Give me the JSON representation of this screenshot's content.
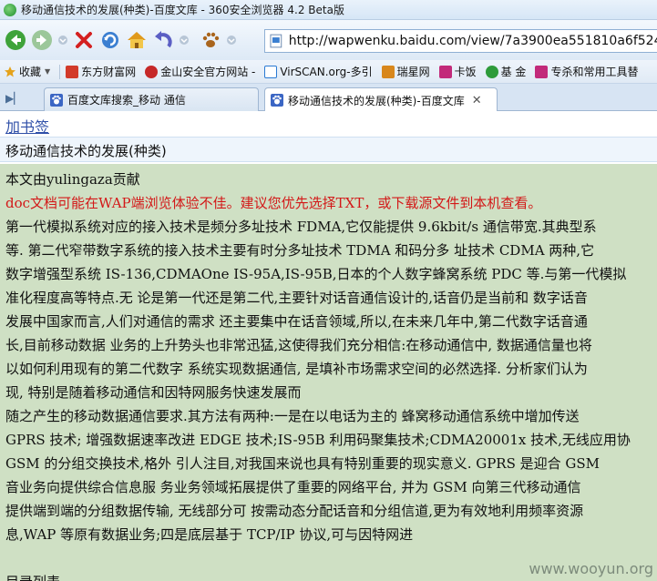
{
  "window": {
    "title": "移动通信技术的发展(种类)-百度文库 - 360安全浏览器 4.2 Beta版"
  },
  "toolbar": {
    "buttons": [
      "back-icon",
      "forward-icon",
      "dropdown-icon",
      "stop-icon",
      "refresh-icon",
      "home-icon",
      "undo-icon",
      "dropdown-icon",
      "paw-icon",
      "dropdown-icon"
    ],
    "url": "http://wapwenku.baidu.com/view/7a3900ea551810a6f52486"
  },
  "bookmarks": [
    {
      "label": "收藏",
      "color": "#e5a21a"
    },
    {
      "label": "东方财富网",
      "color": "#d23a2a"
    },
    {
      "label": "金山安全官方网站 -",
      "color": "#c62828"
    },
    {
      "label": "VirSCAN.org-多引",
      "color": "#2a7ad3"
    },
    {
      "label": "瑞星网",
      "color": "#d8871c"
    },
    {
      "label": "卡饭",
      "color": "#c22a7a"
    },
    {
      "label": "基 金",
      "color": "#2e9b3a"
    },
    {
      "label": "专杀和常用工具替",
      "color": "#c22a7a"
    }
  ],
  "tabs": [
    {
      "label": "百度文库搜索_移动 通信"
    },
    {
      "label": "移动通信技术的发展(种类)-百度文库"
    }
  ],
  "page": {
    "add_bookmark": "加书签",
    "doc_title": "移动通信技术的发展(种类)",
    "contributor": "本文由yulingaza贡献",
    "warning": "doc文档可能在WAP端浏览体验不佳。建议您优先选择TXT，或下载源文件到本机查看。",
    "lines": [
      "第一代模拟系统对应的接入技术是频分多址技术  FDMA,它仅能提供  9.6kbit/s 通信带宽.其典型系",
      "等. 第二代窄带数字系统的接入技术主要有时分多址技术  TDMA 和码分多  址技术  CDMA 两种,它",
      "数字增强型系统  IS-136,CDMAOne IS-95A,IS-95B,日本的个人数字蜂窝系统  PDC 等.与第一代模拟",
      "准化程度高等特点.无  论是第一代还是第二代,主要针对话音通信设计的,话音仍是当前和  数字话音",
      "发展中国家而言,人们对通信的需求  还主要集中在话音领域,所以,在未来几年中,第二代数字话音通",
      "长,目前移动数据  业务的上升势头也非常迅猛,这使得我们充分相信:在移动通信中, 数据通信量也将",
      "以如何利用现有的第二代数字  系统实现数据通信, 是填补市场需求空间的必然选择. 分析家们认为",
      "现, 特别是随着移动通信和因特网服务快速发展而",
      "随之产生的移动数据通信要求.其方法有两种:一是在以电话为主的  蜂窝移动通信系统中增加传送",
      "GPRS 技术; 增强数据速率改进  EDGE 技术;IS-95B 利用码聚集技术;CDMA20001x 技术,无线应用协",
      "GSM 的分组交换技术,格外  引人注目,对我国来说也具有特别重要的现实意义. GPRS 是迎合  GSM",
      "音业务向提供综合信息服  务业务领域拓展提供了重要的网络平台, 并为  GSM 向第三代移动通信",
      "提供端到端的分组数据传输, 无线部分可  按需动态分配话音和分组信道,更为有效地利用频率资源",
      "息,WAP 等原有数据业务;四是底层基于  TCP/IP 协议,可与因特网进"
    ],
    "footer_partial": "目录列表",
    "watermark": "www.wooyun.org"
  }
}
